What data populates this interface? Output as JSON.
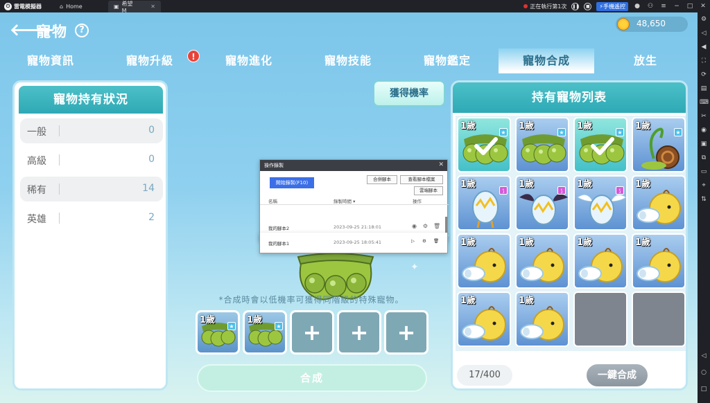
{
  "titlebar": {
    "app_name": "雷電模擬器",
    "tabs": [
      {
        "label": "Home",
        "icon": "home-icon"
      },
      {
        "label": "希望M",
        "icon": "game-icon"
      }
    ],
    "run_status": "正在執行第1次",
    "remote_label": "手機遙控"
  },
  "header": {
    "title": "寵物",
    "coins": "48,650",
    "back_icon": "back-arrow-icon",
    "help_symbol": "?"
  },
  "tabs": [
    {
      "label": "寵物資訊",
      "active": false
    },
    {
      "label": "寵物升級",
      "active": false,
      "badge": "!"
    },
    {
      "label": "寵物進化",
      "active": false
    },
    {
      "label": "寵物技能",
      "active": false
    },
    {
      "label": "寵物鑑定",
      "active": false
    },
    {
      "label": "寵物合成",
      "active": true
    },
    {
      "label": "放生",
      "active": false
    }
  ],
  "holdings": {
    "title": "寵物持有狀況",
    "rows": [
      {
        "name": "一般",
        "value": "0"
      },
      {
        "name": "高級",
        "value": "0"
      },
      {
        "name": "稀有",
        "value": "14"
      },
      {
        "name": "英雄",
        "value": "2"
      }
    ]
  },
  "rate_button": "獲得機率",
  "macro_dialog": {
    "title": "操作錄製",
    "record_button": "開始錄製(F10)",
    "buttons": [
      "合併腳本",
      "查看腳本檔案",
      "雲端腳本"
    ],
    "columns": [
      "名稱",
      "錄製時間 ▾",
      "操作"
    ],
    "rows": [
      {
        "name": "我的腳本2",
        "time": "2023-09-25 21:18:01"
      },
      {
        "name": "我的腳本1",
        "time": "2023-09-25 18:05:41"
      }
    ]
  },
  "merge": {
    "note": "*合成時會以低機率可獲得同階級的特殊寵物。",
    "slots": [
      {
        "age": "1歲",
        "filled": true
      },
      {
        "age": "1歲",
        "filled": true
      },
      {
        "filled": false
      },
      {
        "filled": false
      },
      {
        "filled": false
      }
    ],
    "button": "合成"
  },
  "owned": {
    "title": "持有寵物列表",
    "count": "17/400",
    "one_key_button": "一鍵合成",
    "pets": [
      {
        "age": "1歲",
        "type": "pea",
        "selected": true,
        "badge": "star"
      },
      {
        "age": "1歲",
        "type": "pea",
        "selected": false,
        "badge": "star"
      },
      {
        "age": "1歲",
        "type": "pea",
        "selected": true,
        "badge": "star"
      },
      {
        "age": "1歲",
        "type": "snail",
        "selected": false,
        "badge": "star"
      },
      {
        "age": "1歲",
        "type": "egg-legs",
        "selected": false,
        "badge": "wing"
      },
      {
        "age": "1歲",
        "type": "egg-bat",
        "selected": false,
        "badge": "wing"
      },
      {
        "age": "1歲",
        "type": "egg-angel",
        "selected": false,
        "badge": "wing"
      },
      {
        "age": "1歲",
        "type": "chick",
        "selected": false
      },
      {
        "age": "1歲",
        "type": "chick",
        "selected": false
      },
      {
        "age": "1歲",
        "type": "chick",
        "selected": false
      },
      {
        "age": "1歲",
        "type": "chick",
        "selected": false
      },
      {
        "age": "1歲",
        "type": "chick",
        "selected": false
      },
      {
        "age": "1歲",
        "type": "chick",
        "selected": false
      },
      {
        "age": "1歲",
        "type": "chick",
        "selected": false
      },
      {
        "type": "empty"
      },
      {
        "type": "empty"
      }
    ]
  }
}
